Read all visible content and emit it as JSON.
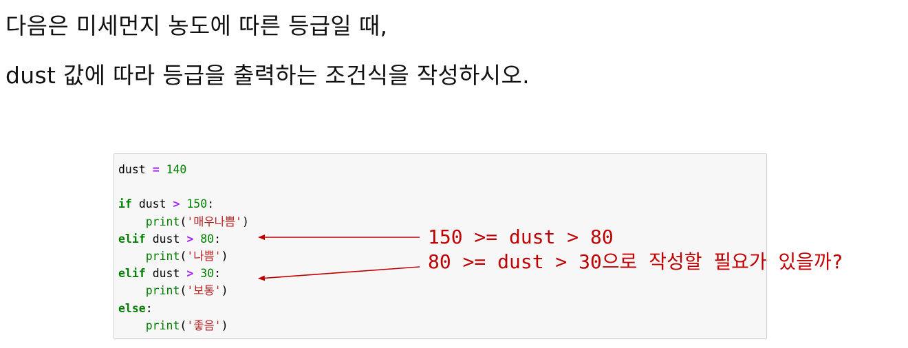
{
  "instructions": {
    "line1": "다음은 미세먼지 농도에 따른 등급일 때,",
    "line2": "dust 값에 따라 등급을 출력하는 조건식을 작성하시오."
  },
  "code": {
    "assign_var": "dust",
    "assign_op": "=",
    "assign_value": "140",
    "if_kw": "if",
    "if_var": "dust",
    "if_op": ">",
    "if_value": "150",
    "if_colon": ":",
    "print1_fn": "print",
    "print1_str": "'매우나쁨'",
    "elif1_kw": "elif",
    "elif1_var": "dust",
    "elif1_op": ">",
    "elif1_value": "80",
    "elif1_colon": ":",
    "print2_fn": "print",
    "print2_str": "'나쁨'",
    "elif2_kw": "elif",
    "elif2_var": "dust",
    "elif2_op": ">",
    "elif2_value": "30",
    "elif2_colon": ":",
    "print3_fn": "print",
    "print3_str": "'보통'",
    "else_kw": "else",
    "else_colon": ":",
    "print4_fn": "print",
    "print4_str": "'좋음'"
  },
  "annotations": {
    "note1": "150 >= dust > 80",
    "note2": "80 >= dust > 30으로 작성할 필요가 있을까?"
  },
  "colors": {
    "annotation": "#c00000",
    "keyword": "#008000",
    "operator": "#aa22ff",
    "string": "#ba2121",
    "cell_background": "#f7f7f7"
  }
}
